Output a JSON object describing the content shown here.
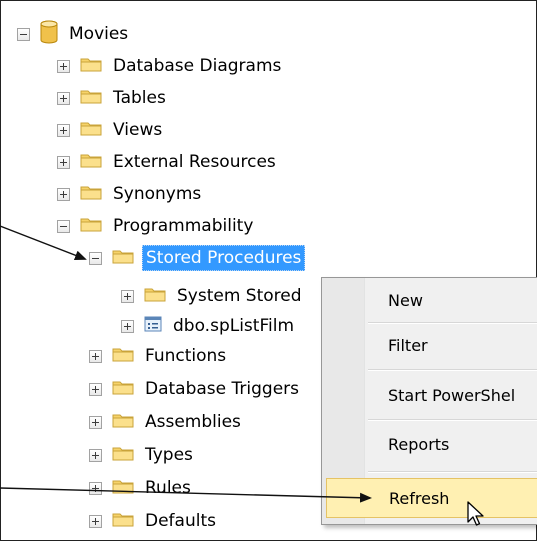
{
  "tree": {
    "root": "Movies",
    "items": [
      {
        "label": "Database Diagrams"
      },
      {
        "label": "Tables"
      },
      {
        "label": "Views"
      },
      {
        "label": "External Resources"
      },
      {
        "label": "Synonyms"
      },
      {
        "label": "Programmability"
      },
      {
        "label": "Stored Procedures"
      },
      {
        "label": "System Stored"
      },
      {
        "label": "dbo.spListFilm"
      },
      {
        "label": "Functions"
      },
      {
        "label": "Database Triggers"
      },
      {
        "label": "Assemblies"
      },
      {
        "label": "Types"
      },
      {
        "label": "Rules"
      },
      {
        "label": "Defaults"
      }
    ]
  },
  "context_menu": {
    "items": [
      {
        "label": "New"
      },
      {
        "label": "Filter"
      },
      {
        "label": "Start PowerShel"
      },
      {
        "label": "Reports"
      },
      {
        "label": "Refresh"
      }
    ],
    "highlighted": "Refresh"
  },
  "colors": {
    "selection": "#3399ff",
    "menu_highlight": "#fff0b2",
    "folder": "#f6d36a"
  }
}
